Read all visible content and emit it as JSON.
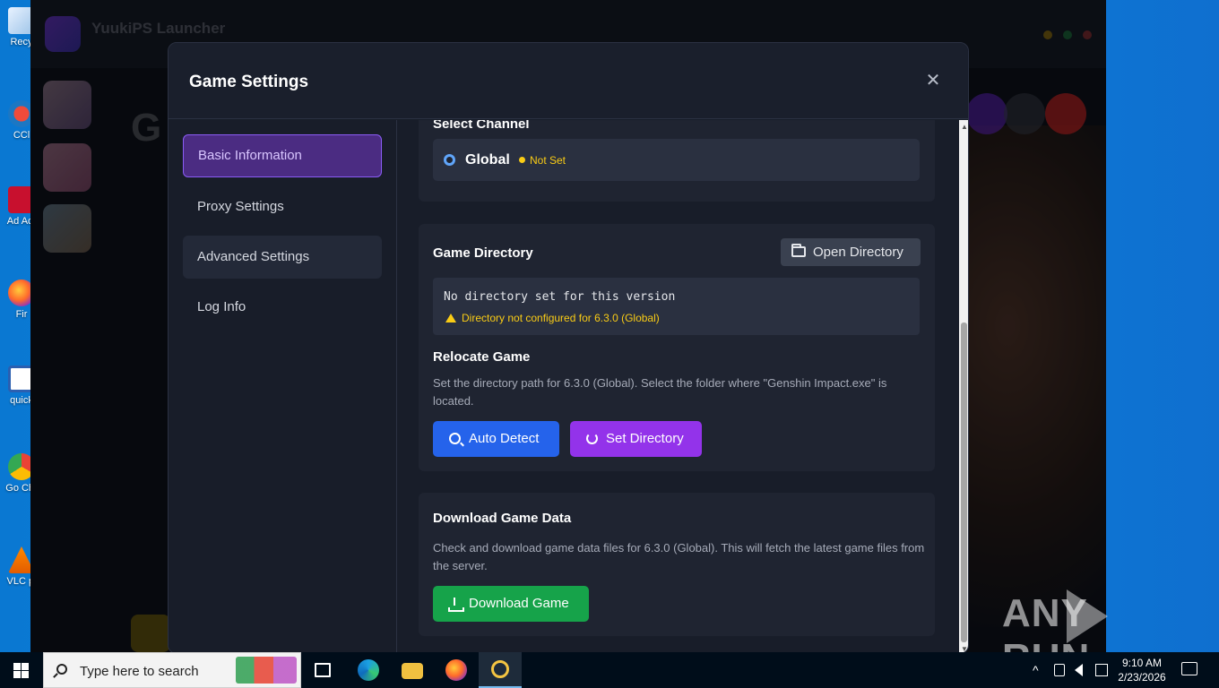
{
  "desktop": {
    "icons": [
      {
        "label": "Recy",
        "icon": "recycle-bin-icon"
      },
      {
        "label": "CCl",
        "icon": "ccleaner-icon"
      },
      {
        "label": "Ad Acr",
        "icon": "acrobat-icon"
      },
      {
        "label": "Fir",
        "icon": "firefox-icon"
      },
      {
        "label": "quick",
        "icon": "word-icon"
      },
      {
        "label": "Go Chr",
        "icon": "chrome-icon"
      },
      {
        "label": "VLC pl",
        "icon": "vlc-icon"
      }
    ]
  },
  "launcher": {
    "title": "YuukiPS Launcher",
    "big_letter": "G"
  },
  "modal": {
    "title": "Game Settings",
    "close_symbol": "✕",
    "nav": [
      {
        "label": "Basic Information",
        "active": true
      },
      {
        "label": "Proxy Settings",
        "active": false
      },
      {
        "label": "Advanced Settings",
        "active": false
      },
      {
        "label": "Log Info",
        "active": false
      }
    ],
    "channel": {
      "title": "Select Channel",
      "option": "Global",
      "status": "Not Set"
    },
    "directory": {
      "title": "Game Directory",
      "open_button": "Open Directory",
      "path_text": "No directory set for this version",
      "warning": "Directory not configured for 6.3.0 (Global)"
    },
    "relocate": {
      "title": "Relocate Game",
      "description": "Set the directory path for 6.3.0 (Global). Select the folder where \"Genshin Impact.exe\" is located.",
      "auto_detect_button": "Auto Detect",
      "set_directory_button": "Set Directory"
    },
    "download": {
      "title": "Download Game Data",
      "description": "Check and download game data files for 6.3.0 (Global). This will fetch the latest game files from the server.",
      "button": "Download Game"
    }
  },
  "watermark": {
    "left": "ANY",
    "right": "RUN"
  },
  "taskbar": {
    "search_placeholder": "Type here to search",
    "pinned": [
      "task-view-icon",
      "edge-icon",
      "file-explorer-icon",
      "firefox-icon",
      "launcher-icon"
    ],
    "tray": {
      "chevron": "^"
    },
    "time": "9:10 AM",
    "date": "2/23/2026"
  },
  "colors": {
    "accent_purple": "#9333ea",
    "accent_blue": "#2563eb",
    "accent_green": "#16a34a",
    "warning": "#facc15",
    "nav_active_bg": "#4b2c82"
  }
}
